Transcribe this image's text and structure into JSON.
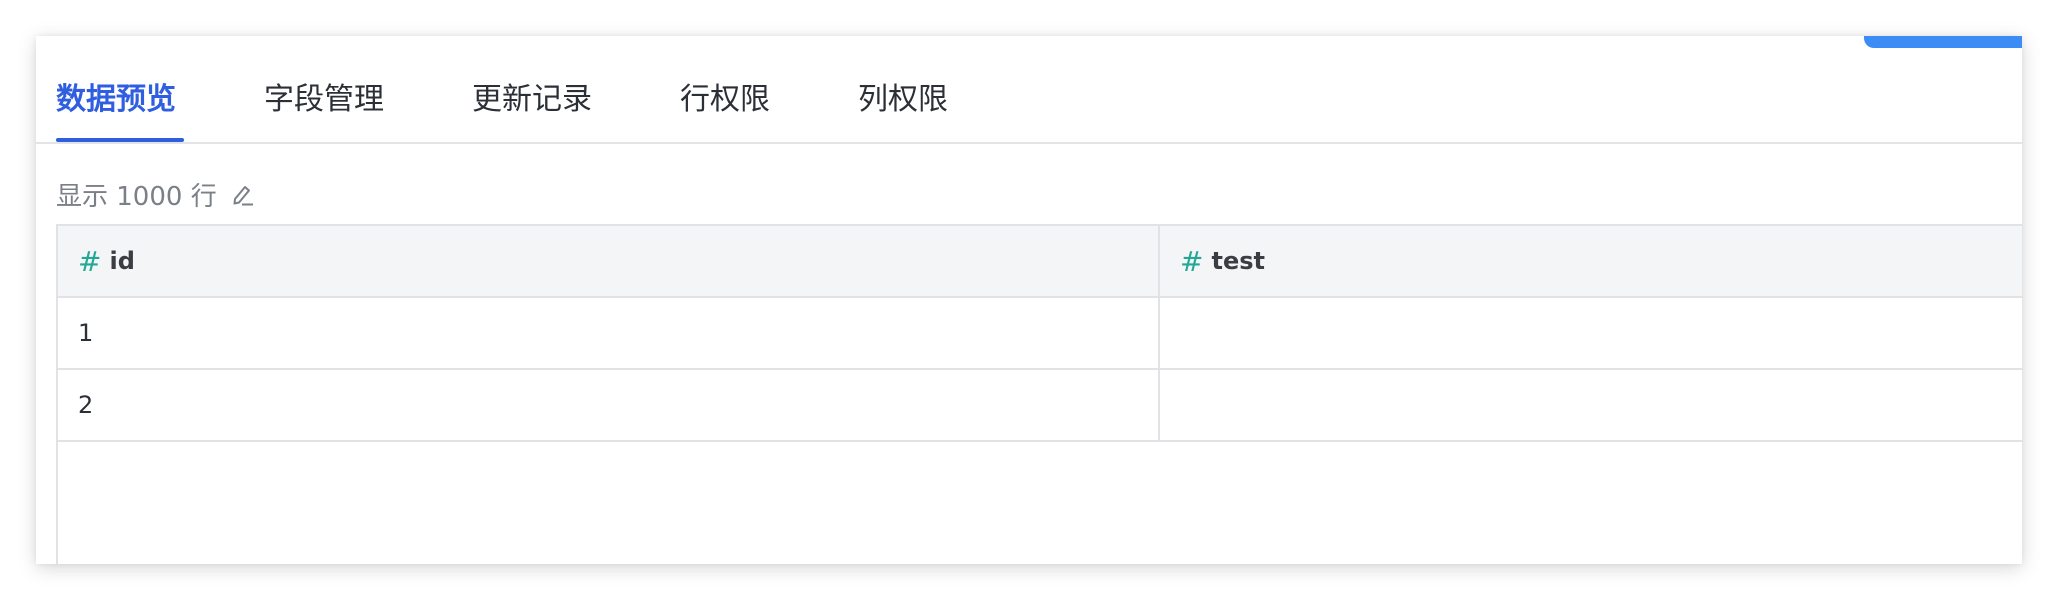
{
  "tabs": [
    {
      "label": "数据预览",
      "active": true
    },
    {
      "label": "字段管理",
      "active": false
    },
    {
      "label": "更新记录",
      "active": false
    },
    {
      "label": "行权限",
      "active": false
    },
    {
      "label": "列权限",
      "active": false
    }
  ],
  "rows_setting": {
    "label": "显示 1000 行",
    "icon": "pencil-icon"
  },
  "table": {
    "columns": [
      {
        "type_icon": "#",
        "name": "id"
      },
      {
        "type_icon": "#",
        "name": "test"
      }
    ],
    "rows": [
      [
        "1",
        ""
      ],
      [
        "2",
        ""
      ]
    ]
  },
  "colors": {
    "accent": "#2f5fe0",
    "type_icon": "#23a896",
    "corner_accent": "#3b8cf5"
  }
}
